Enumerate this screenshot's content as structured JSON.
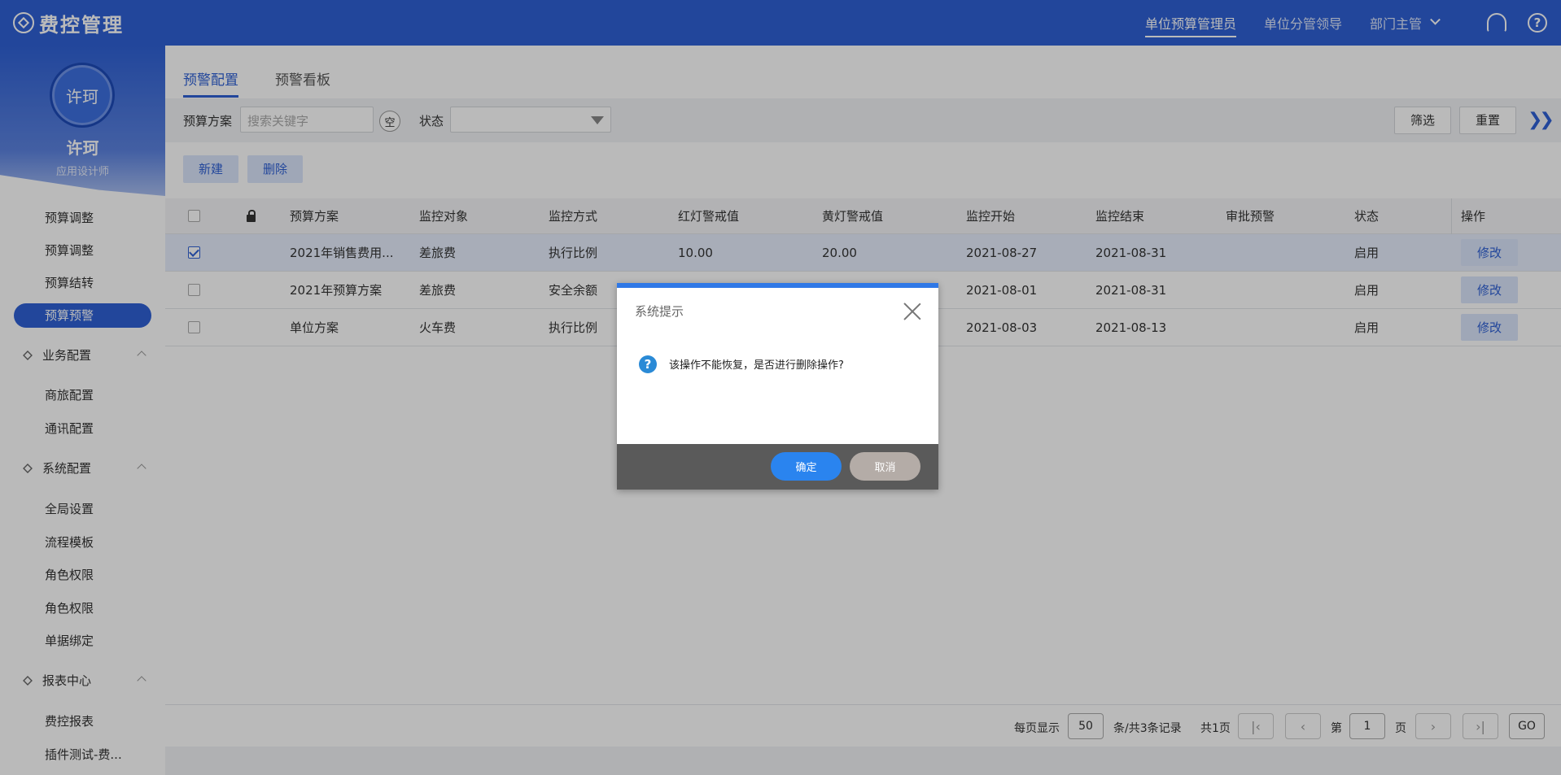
{
  "header": {
    "logo_text": "费控管理",
    "roles": [
      "单位预算管理员",
      "单位分管领导",
      "部门主管"
    ]
  },
  "user": {
    "avatar_text": "许珂",
    "name": "许珂",
    "role": "应用设计师"
  },
  "sidebar": {
    "items": [
      {
        "label": "预算调整",
        "type": "item"
      },
      {
        "label": "预算调整",
        "type": "item"
      },
      {
        "label": "预算结转",
        "type": "item"
      },
      {
        "label": "预算预警",
        "type": "item",
        "active": true
      },
      {
        "label": "业务配置",
        "type": "group"
      },
      {
        "label": "商旅配置",
        "type": "item"
      },
      {
        "label": "通讯配置",
        "type": "item"
      },
      {
        "label": "系统配置",
        "type": "group"
      },
      {
        "label": "全局设置",
        "type": "item"
      },
      {
        "label": "流程模板",
        "type": "item"
      },
      {
        "label": "角色权限",
        "type": "item"
      },
      {
        "label": "角色权限",
        "type": "item"
      },
      {
        "label": "单据绑定",
        "type": "item"
      },
      {
        "label": "报表中心",
        "type": "group"
      },
      {
        "label": "费控报表",
        "type": "item"
      },
      {
        "label": "插件测试-费...",
        "type": "item"
      }
    ]
  },
  "tabs": [
    "预警配置",
    "预警看板"
  ],
  "filters": {
    "plan_label": "预算方案",
    "plan_placeholder": "搜索关键字",
    "clear_label": "空",
    "status_label": "状态",
    "filter_btn": "筛选",
    "reset_btn": "重置"
  },
  "actions": {
    "new": "新建",
    "delete": "删除"
  },
  "table": {
    "headers": [
      "预算方案",
      "监控对象",
      "监控方式",
      "红灯警戒值",
      "黄灯警戒值",
      "监控开始",
      "监控结束",
      "审批预警",
      "状态",
      "操作"
    ],
    "rows": [
      {
        "checked": true,
        "plan": "2021年销售费用...",
        "object": "差旅费",
        "method": "执行比例",
        "red": "10.00",
        "yellow": "20.00",
        "start": "2021-08-27",
        "end": "2021-08-31",
        "approval": "",
        "status": "启用",
        "op": "修改"
      },
      {
        "checked": false,
        "plan": "2021年预算方案",
        "object": "差旅费",
        "method": "安全余额",
        "red": "",
        "yellow": "",
        "start": "2021-08-01",
        "end": "2021-08-31",
        "approval": "",
        "status": "启用",
        "op": "修改"
      },
      {
        "checked": false,
        "plan": "单位方案",
        "object": "火车费",
        "method": "执行比例",
        "red": "",
        "yellow": "",
        "start": "2021-08-03",
        "end": "2021-08-13",
        "approval": "",
        "status": "启用",
        "op": "修改"
      }
    ]
  },
  "pagination": {
    "per_page_label": "每页显示",
    "per_page": "50",
    "records": "条/共3条记录",
    "total_pages": "共1页",
    "page_prefix": "第",
    "page": "1",
    "page_suffix": "页",
    "go": "GO"
  },
  "modal": {
    "title": "系统提示",
    "message": "该操作不能恢复，是否进行删除操作?",
    "ok": "确定",
    "cancel": "取消"
  },
  "colors": {
    "primary": "#2f61d5",
    "ok_button": "#2a84ef",
    "cancel_button": "#b4aca7"
  }
}
